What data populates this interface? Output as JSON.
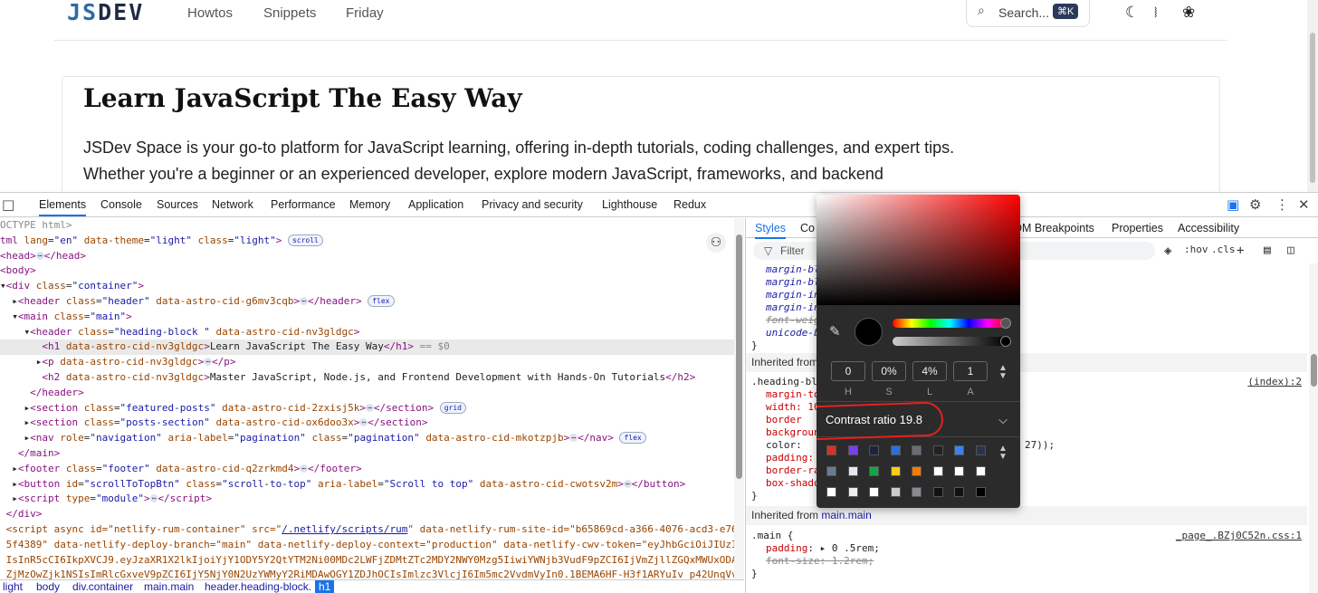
{
  "site": {
    "logo": {
      "a": "JS",
      "b": "DEV"
    },
    "nav": [
      "Howtos",
      "Snippets",
      "Friday"
    ],
    "search": {
      "label": "Search...",
      "shortcut": "⌘K"
    },
    "heading": "Learn JavaScript The Easy Way",
    "paragraph": "JSDev Space is your go-to platform for JavaScript learning, offering in-depth tutorials, coding challenges, and expert tips. Whether you're a beginner or an experienced developer, explore modern JavaScript, frameworks, and backend"
  },
  "devtools": {
    "tabs": [
      "Elements",
      "Console",
      "Sources",
      "Network",
      "Performance",
      "Memory",
      "Application",
      "Privacy and security",
      "Lighthouse",
      "Redux"
    ],
    "active_tab": "Elements",
    "sidebar_tabs": [
      "Styles",
      "Co",
      "DM Breakpoints",
      "Properties",
      "Accessibility"
    ],
    "filter_placeholder": "Filter",
    "tools": {
      "hov": ":hov",
      "cls": ".cls"
    },
    "breadcrumb": [
      "light",
      "body",
      "div.container",
      "main.main",
      "header.heading-block.",
      "h1"
    ],
    "dom": {
      "doctype": "OCTYPE html>",
      "html_open": [
        "tml ",
        "lang",
        "\"en\"",
        "data-theme",
        "\"light\"",
        "class",
        "\"light\""
      ],
      "scroll_badge": "scroll",
      "flex_badge": "flex",
      "grid_badge": "grid",
      "selected_marker": "== $0",
      "h1_text": "Learn JavaScript The Easy Way",
      "h2_text": "Master JavaScript, Node.js, and Frontend Development with Hands-On Tutorials",
      "script_src": "/.netlify/scripts/rum",
      "script_line1": "<script async id=\"netlify-rum-container\" src=\"",
      "script_line1b": "\" data-netlify-rum-site-id=\"b65869cd-a366-4076-acd3-e76066",
      "script_line2": "5f4389\" data-netlify-deploy-branch=\"main\" data-netlify-deploy-context=\"production\" data-netlify-cwv-token=\"eyJhbGciOiJIUzI1Ni",
      "script_line3": "IsInR5cCI6IkpXVCJ9.eyJzaXR1X2lkIjoiYjY1ODY5Y2QtYTM2Ni00MDc2LWFjZDMtZTc2MDY2NWY0Mzg5IiwiYWNjb3VudF9pZCI6IjVmZjllZGQxMWUxODA5Nz",
      "script_line4": "ZjMzOwZjk1NSIsImRlcGxveV9pZCI6IjY5NjY0N2UzYWMyY2RiMDAwOGY1ZDJhOCIsImlzc3VlcjI6Im5mc2VvdmVyIn0.1BEMA6HF-H3f1ARYuIv_p42UnqVvMpI"
    },
    "styles": {
      "rules_top": [
        "margin-bl",
        "margin-bl",
        "margin-in",
        "margin-in",
        "font-weig",
        "unicode-b"
      ],
      "inherited1": "Inherited from",
      "heading_selector": ".heading-blo",
      "heading_src": "(index):2",
      "heading_props": [
        "margin-to",
        "width: 10",
        "border",
        "backgroun",
        "color:",
        "padding:",
        "border-ra",
        "box-shado"
      ],
      "color_tail": "27));",
      "inherited2_label": "Inherited from",
      "inherited2_link": "main.main",
      "main_selector": ".main {",
      "main_src": "_page_.BZj0C52n.css:1",
      "main_padding_prop": "padding",
      "main_padding_val": "0 .5rem;",
      "main_fontsize_prop": "font-size",
      "main_fontsize_val": "1.2rem;",
      "close_brace": "}"
    },
    "color_picker": {
      "h": "0",
      "s": "0%",
      "l": "4%",
      "a": "1",
      "labels": [
        "H",
        "S",
        "L",
        "A"
      ],
      "contrast_label": "Contrast ratio",
      "contrast_value": "19.8",
      "palette": [
        "#d93025",
        "#7b3ff2",
        "#1f2340",
        "#2b6fdc",
        "#6b6e75",
        "#222222",
        "#3b82f6",
        "#2a3350",
        "#6b7a90",
        "#e3e8f0",
        "#16a34a",
        "#facc15",
        "#f57c00",
        "#ffffff",
        "#ffffff",
        "#ffffff",
        "#ffffff",
        "#eeeeee",
        "#ffffff",
        "#cccccc",
        "#888a8f",
        "#111111",
        "#111111",
        "#000000"
      ]
    }
  }
}
